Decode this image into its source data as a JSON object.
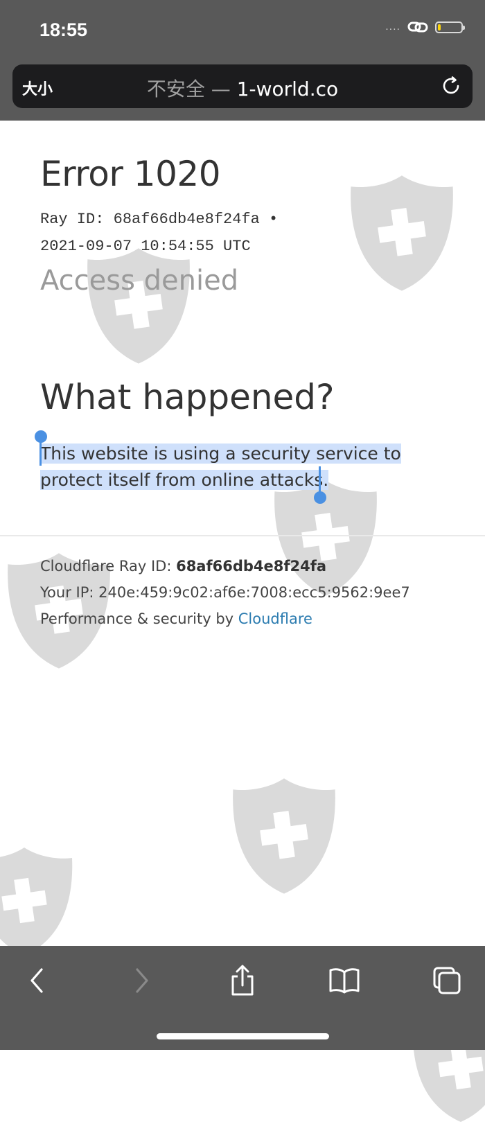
{
  "status_bar": {
    "time": "18:55",
    "signal": "....",
    "icons": [
      "link-icon",
      "battery-icon"
    ],
    "battery_level_fraction": 0.1
  },
  "address_bar": {
    "text_size_label": "大小",
    "insecure_label": "不安全",
    "separator": " — ",
    "domain": "1-world.co",
    "icons": [
      "reload-icon"
    ]
  },
  "page": {
    "error_title": "Error 1020",
    "ray_line1": "Ray ID: 68af66db4e8f24fa •",
    "ray_line2": "2021-09-07 10:54:55 UTC",
    "access_denied": "Access denied",
    "what_happened": "What happened?",
    "explanation_line1": "This website is using a security service to",
    "explanation_line2": "protect itself from online attacks."
  },
  "footer": {
    "ray_label": "Cloudflare Ray ID: ",
    "ray_value": "68af66db4e8f24fa",
    "ip_label": "Your IP: ",
    "ip_value": "240e:459:9c02:af6e:7008:ecc5:9562:9ee7",
    "perf_label": "Performance & security by ",
    "cloudflare_link": "Cloudflare"
  },
  "toolbar": {
    "icons": [
      "back-icon",
      "forward-icon",
      "share-icon",
      "bookmarks-icon",
      "tabs-icon"
    ]
  },
  "colors": {
    "bars": "#595959",
    "address_bg": "#1c1c1e",
    "selection": "#cfe0fb",
    "handle": "#4a90e2",
    "link": "#2c7cb0",
    "watermark": "#d6d6d6"
  }
}
